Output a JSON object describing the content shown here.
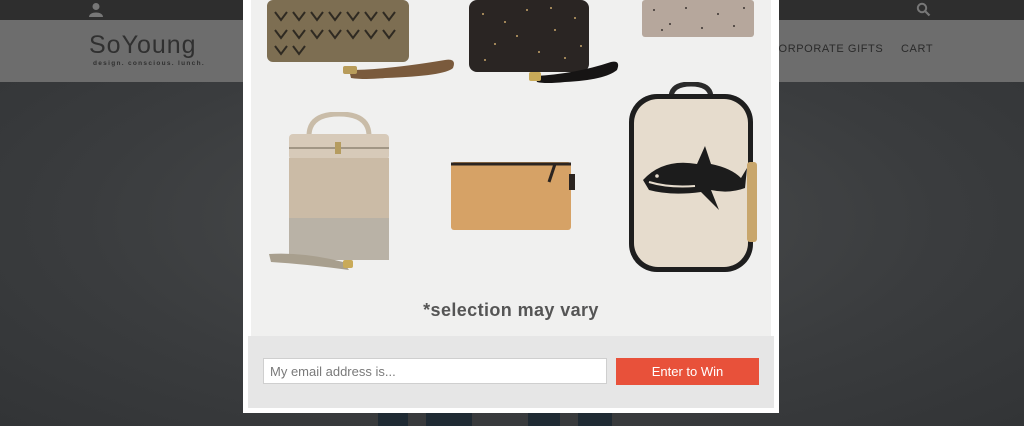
{
  "site": {
    "logo": {
      "name": "SoYoung",
      "tagline": "design. conscious. lunch."
    },
    "nav": {
      "corporate_gifts": "CORPORATE GIFTS",
      "cart": "CART"
    },
    "icons": {
      "account": "user-icon",
      "search": "search-icon"
    }
  },
  "modal": {
    "caption": "*selection may vary",
    "form": {
      "email_placeholder": "My email address is...",
      "email_value": "",
      "submit_label": "Enter to Win"
    },
    "products": [
      "olive-chevron-lunch-bag",
      "black-gold-speckle-lunch-bag",
      "blush-speckle-pouch",
      "linen-lunch-cooler",
      "kraft-zipper-pouch",
      "shark-toddler-backpack"
    ]
  },
  "colors": {
    "accent": "#e8513a",
    "overlay": "#3f4244",
    "form_band": "#e6e6e6"
  }
}
